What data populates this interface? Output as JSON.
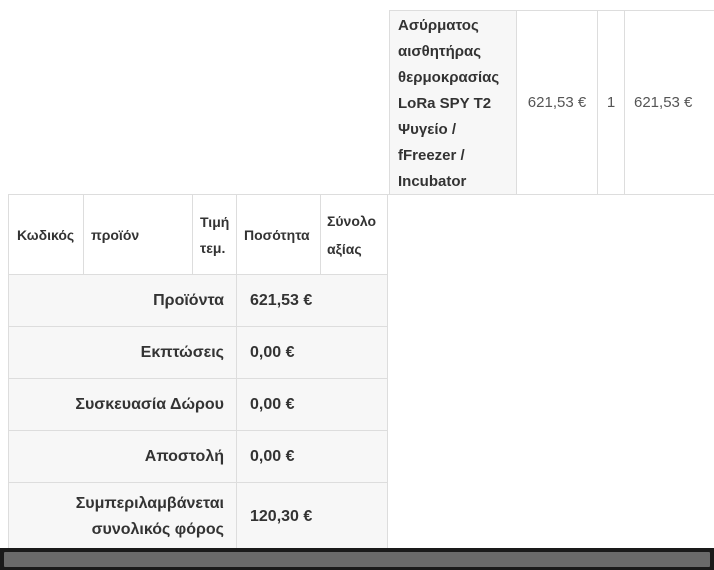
{
  "product_row": {
    "name": "Ασύρματος αισθητήρας θερμοκρασίας LoRa SPY T2 Ψυγείο / fFreezer / Incubator",
    "unit_price": "621,53 €",
    "quantity": "1",
    "total": "621,53 €"
  },
  "header": {
    "code": "Κωδικός",
    "product": "προϊόν",
    "unit_price": "Τιμή τεμ.",
    "quantity": "Ποσότητα",
    "total_value": "Σύνολο αξίας"
  },
  "summary": [
    {
      "label": "Προϊόντα",
      "value": "621,53 €"
    },
    {
      "label": "Εκπτώσεις",
      "value": "0,00 €"
    },
    {
      "label": "Συσκευασία Δώρου",
      "value": "0,00 €"
    },
    {
      "label": "Αποστολή",
      "value": "0,00 €"
    },
    {
      "label": "Συμπεριλαμβάνεται συνολικός φόρος",
      "value": "120,30 €"
    }
  ]
}
